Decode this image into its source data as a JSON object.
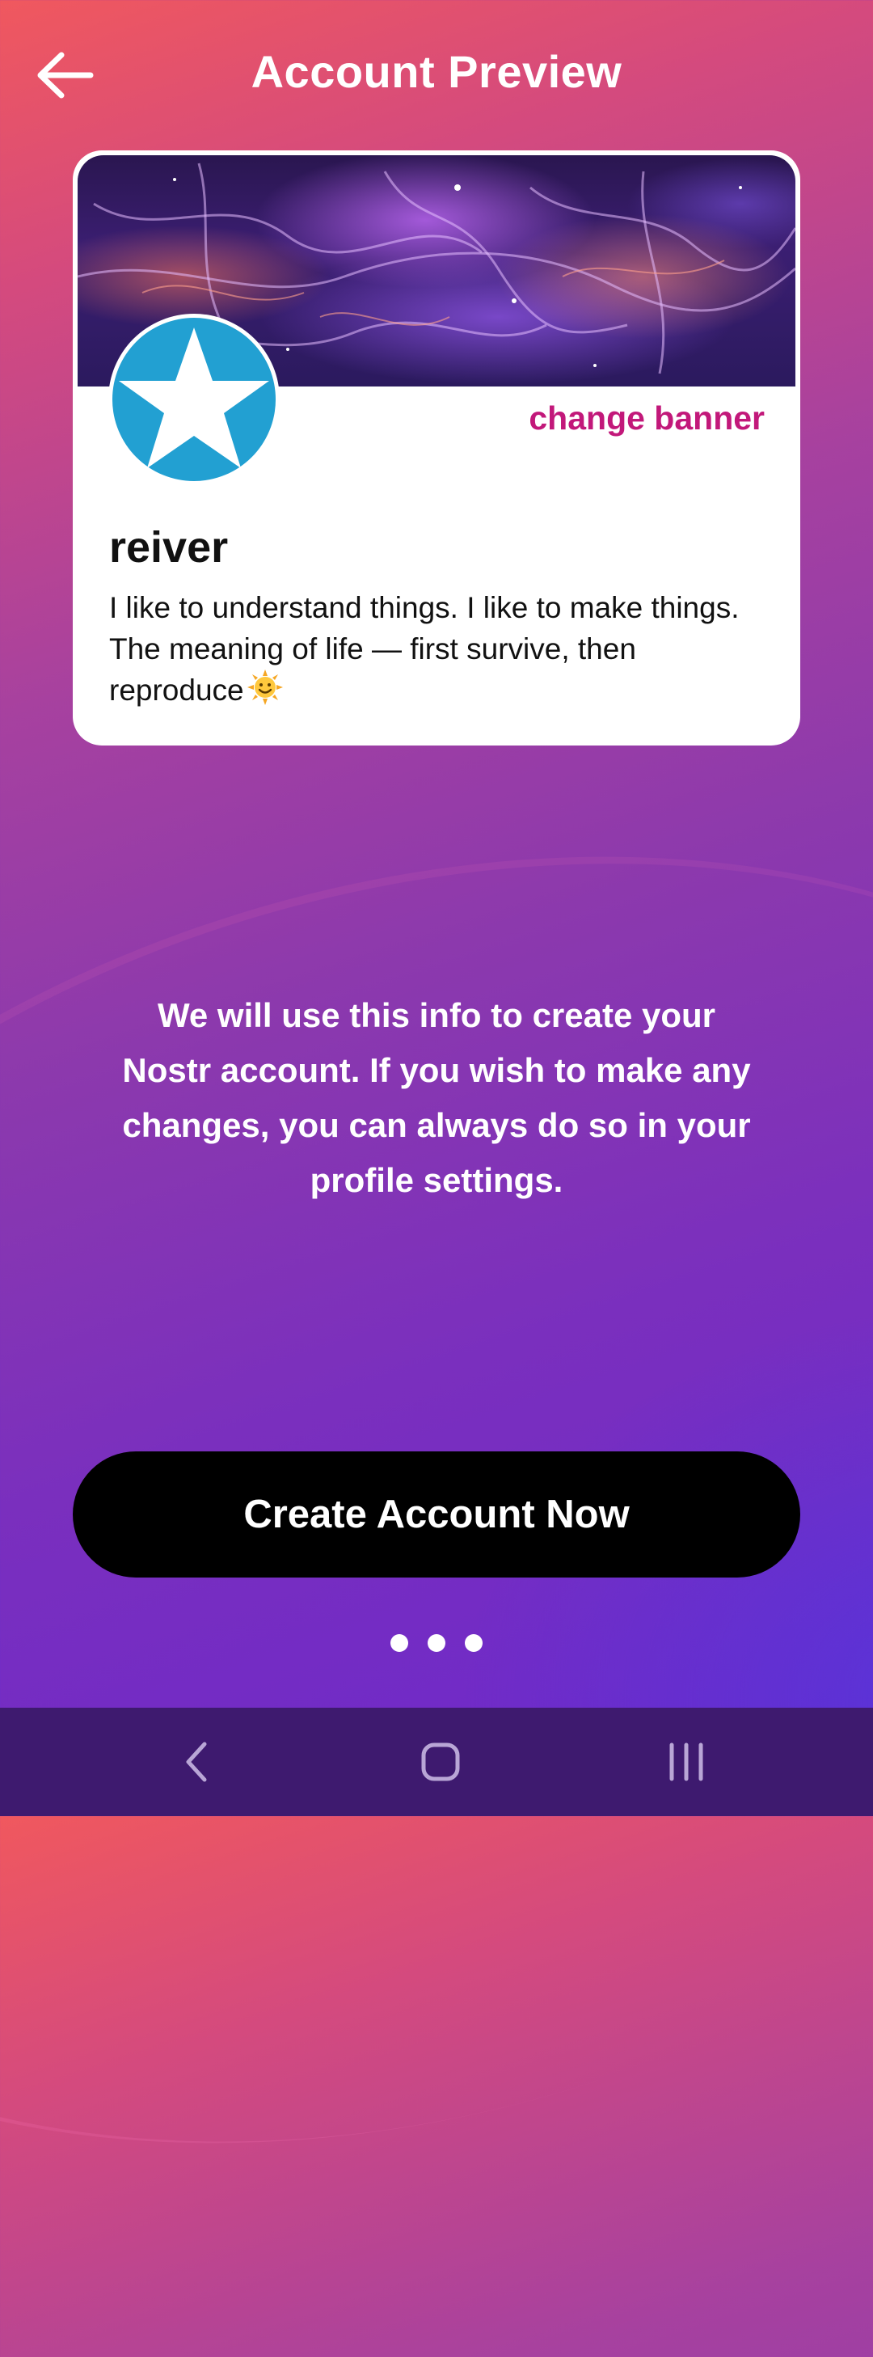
{
  "header": {
    "title": "Account Preview",
    "back_icon": "arrow-left-icon"
  },
  "profile_card": {
    "change_banner_label": "change banner",
    "avatar_icon": "star-icon",
    "avatar_color": "#22a0d2",
    "username": "reiver",
    "bio": "I like to understand things. I like to make things. The meaning of life — first survive, then reproduce",
    "bio_emoji_icon": "smiling-sun-icon",
    "accent_color": "#c2187a"
  },
  "info": {
    "message": "We will use this info to create your Nostr account. If you wish to make any changes, you can always do so in your profile settings."
  },
  "actions": {
    "create_account_label": "Create Account Now"
  },
  "pagination": {
    "total_dots": 3
  },
  "system_nav": {
    "back_icon": "nav-back-icon",
    "home_icon": "nav-home-icon",
    "recents_icon": "nav-recents-icon"
  }
}
